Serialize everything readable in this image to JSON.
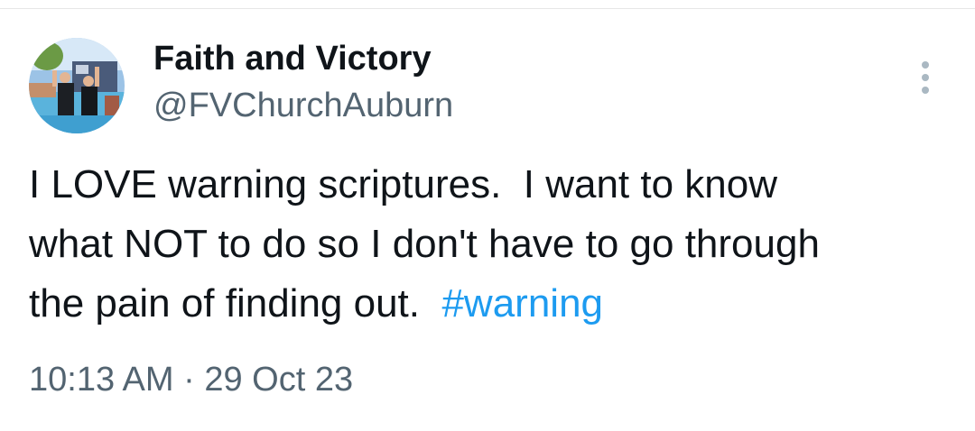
{
  "author": {
    "display_name": "Faith and Victory",
    "handle": "@FVChurchAuburn",
    "avatar_icon": "profile-photo"
  },
  "more_menu": {
    "icon": "more-vertical-icon"
  },
  "tweet": {
    "line1": "I LOVE warning scriptures.  I want to know",
    "line2": "what NOT to do so I don't have to go through",
    "line3_text": "the pain of finding out.  ",
    "hashtag": "#warning"
  },
  "meta": {
    "time": "10:13 AM",
    "separator": " · ",
    "date": "29 Oct 23"
  },
  "colors": {
    "text": "#0f1419",
    "secondary": "#536471",
    "link": "#1d9bf0"
  }
}
